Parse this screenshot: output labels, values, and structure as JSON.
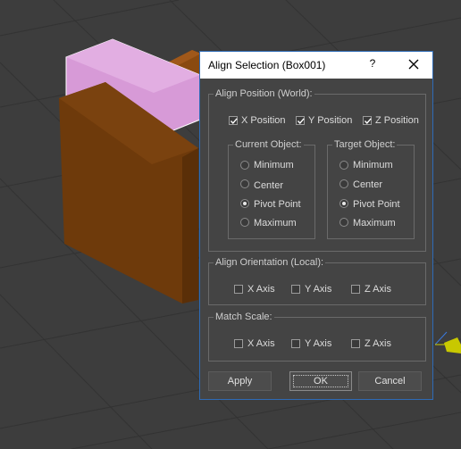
{
  "dialog": {
    "title": "Align Selection (Box001)",
    "help_label": "?"
  },
  "align_position": {
    "label": "Align Position (World):",
    "x_position": {
      "label": "X Position",
      "checked": true
    },
    "y_position": {
      "label": "Y Position",
      "checked": true
    },
    "z_position": {
      "label": "Z Position",
      "checked": true
    },
    "current_object": {
      "label": "Current Object:",
      "options": [
        "Minimum",
        "Center",
        "Pivot Point",
        "Maximum"
      ],
      "selected": "Pivot Point"
    },
    "target_object": {
      "label": "Target Object:",
      "options": [
        "Minimum",
        "Center",
        "Pivot Point",
        "Maximum"
      ],
      "selected": "Pivot Point"
    }
  },
  "align_orientation": {
    "label": "Align Orientation (Local):",
    "x_axis": {
      "label": "X Axis",
      "checked": false
    },
    "y_axis": {
      "label": "Y Axis",
      "checked": false
    },
    "z_axis": {
      "label": "Z Axis",
      "checked": false
    }
  },
  "match_scale": {
    "label": "Match Scale:",
    "x_axis": {
      "label": "X Axis",
      "checked": false
    },
    "y_axis": {
      "label": "Y Axis",
      "checked": false
    },
    "z_axis": {
      "label": "Z Axis",
      "checked": false
    }
  },
  "buttons": {
    "apply": "Apply",
    "ok": "OK",
    "cancel": "Cancel"
  },
  "colors": {
    "viewport_bg": "#3d3d3d",
    "grid_line": "#2f2f2f",
    "box_front": "#6e3a0b",
    "box_side": "#5a2f08",
    "box_selected": "#d79ad7",
    "dialog_bg": "#444444",
    "dialog_border": "#2e6bb6"
  }
}
